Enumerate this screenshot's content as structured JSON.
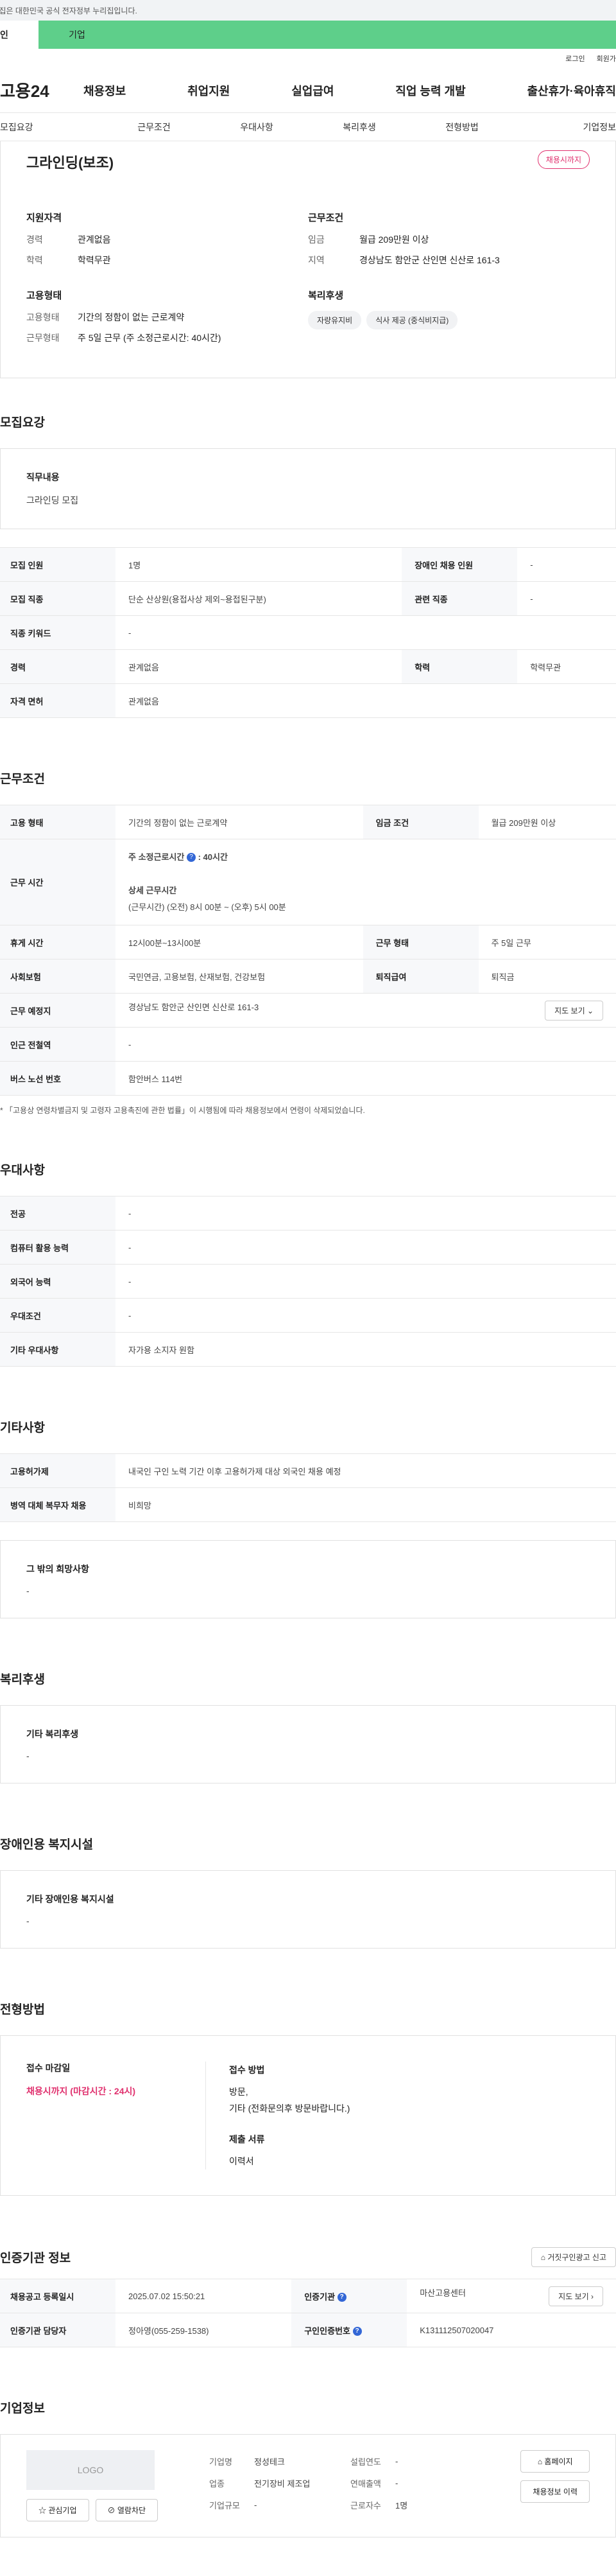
{
  "gov_notice": "이 누리집은 대한민국 공식 전자정부 누리집입니다.",
  "tabs": [
    "인",
    "기업"
  ],
  "util": [
    "로그인",
    "회원가"
  ],
  "gnb": {
    "logo": "고용24",
    "menu": [
      "채용정보",
      "취업지원",
      "실업급여",
      "직업 능력 개발",
      "출산휴가·육아휴직"
    ]
  },
  "anchor": [
    "모집요강",
    "근무조건",
    "우대사항",
    "복리후생",
    "전형방법",
    "기업정보"
  ],
  "summary": {
    "title": "그라인딩(보조)",
    "badge": "채용시까지",
    "qual_title": "지원자격",
    "exp_k": "경력",
    "exp_v": "관계없음",
    "edu_k": "학력",
    "edu_v": "학력무관",
    "emp_title": "고용형태",
    "emp_k": "고용형태",
    "emp_v": "기간의 정함이 없는 근로계약",
    "work_k": "근무형태",
    "work_v": "주 5일 근무 (주 소정근로시간: 40시간)",
    "cond_title": "근무조건",
    "wage_k": "임금",
    "wage_v": "월급 209만원 이상",
    "area_k": "지역",
    "area_v": "경상남도 함안군 산인면 신산로 161-3",
    "welfare_title": "복리후생",
    "chips": [
      "자량유지비",
      "식사 제공 (중식비지급)"
    ]
  },
  "recruit": {
    "title": "모집요강",
    "duty_t": "직무내용",
    "duty_v": "그라인딩 모집",
    "rows": [
      [
        "모집 인원",
        "1명",
        "장애인 채용 인원",
        "-"
      ],
      [
        "모집 직종",
        "단순 산상원(용접사상 제외~용접된구분)",
        "관련 직종",
        "-"
      ],
      [
        "직종 키워드",
        "-"
      ],
      [
        "경력",
        "관계없음",
        "학력",
        "학력무관"
      ],
      [
        "자격 면허",
        "관계없음"
      ]
    ]
  },
  "cond": {
    "title": "근무조건",
    "emp_k": "고용 형태",
    "emp_v": "기간의 정함이 없는 근로계약",
    "wage_k": "임금 조건",
    "wage_v": "월급 209만원 이상",
    "time_k": "근무 시간",
    "time_1": "주 소정근로시간",
    "time_1v": ": 40시간",
    "time_2": "상세 근무시간",
    "time_3": "(근무시간) (오전) 8시 00분 ~ (오후) 5시 00분",
    "rest_k": "휴게 시간",
    "rest_v": "12시00분~13시00분",
    "form_k": "근무 형태",
    "form_v": "주 5일 근무",
    "ins_k": "사회보험",
    "ins_v": "국민연금, 고용보험, 산재보험, 건강보험",
    "ret_k": "퇴직급여",
    "ret_v": "퇴직금",
    "loc_k": "근무 예정지",
    "loc_v": "경상남도 함안군 산인면 신산로 161-3",
    "map": "지도 보기",
    "sub_k": "인근 전철역",
    "sub_v": "-",
    "bus_k": "버스 노선 번호",
    "bus_v": "함안버스 114번",
    "note": "* 「고용상 연령차별금지 및 고령자 고용촉진에 관한 법률」이 시행됨에 따라 채용정보에서 연령이 삭제되었습니다."
  },
  "pref": {
    "title": "우대사항",
    "rows": [
      [
        "전공",
        "-"
      ],
      [
        "컴퓨터 활용 능력",
        "-"
      ],
      [
        "외국어 능력",
        "-"
      ],
      [
        "우대조건",
        "-"
      ],
      [
        "기타 우대사항",
        "자가용 소지자 원함"
      ]
    ]
  },
  "etc": {
    "title": "기타사항",
    "rows": [
      [
        "고용허가제",
        "내국인 구인 노력 기간 이후 고용허가제 대상 외국인 채용 예정"
      ],
      [
        "병역 대체 복무자 채용",
        "비희망"
      ]
    ],
    "other_t": "그 밖의 희망사항",
    "other_v": "-"
  },
  "welfare": {
    "title": "복리후생",
    "t": "기타 복리후생",
    "v": "-"
  },
  "disabled": {
    "title": "장애인용 복지시설",
    "t": "기타 장애인용 복지시설",
    "v": "-"
  },
  "selection": {
    "title": "전형방법",
    "deadline_t": "접수 마감일",
    "deadline_v": "채용시까지 (마감시간 : 24시)",
    "method_t": "접수 방법",
    "method_v1": "방문,",
    "method_v2": "기타 (전화문의후 방문바랍니다.)",
    "docs_t": "제출 서류",
    "docs_v": "이력서"
  },
  "cert": {
    "title": "인증기관 정보",
    "report": "거짓구인광고 신고",
    "r1": [
      "채용공고 등록일시",
      "2025.07.02 15:50:21",
      "인증기관",
      "마산고용센터"
    ],
    "map": "지도 보기",
    "r2": [
      "인증기관 담당자",
      "정아영(055-259-1538)",
      "구인인증번호",
      "K131112507020047"
    ]
  },
  "company": {
    "title": "기업정보",
    "logo": "LOGO",
    "fav": "관심기업",
    "follow": "열람차단",
    "rows": [
      [
        "기업명",
        "정성테크",
        "설립연도",
        "-"
      ],
      [
        "업종",
        "전기장비 제조업",
        "연매출액",
        "-"
      ],
      [
        "기업규모",
        "-",
        "근로자수",
        "1명"
      ]
    ],
    "home": "홈페이지",
    "history": "채용정보 이력"
  }
}
